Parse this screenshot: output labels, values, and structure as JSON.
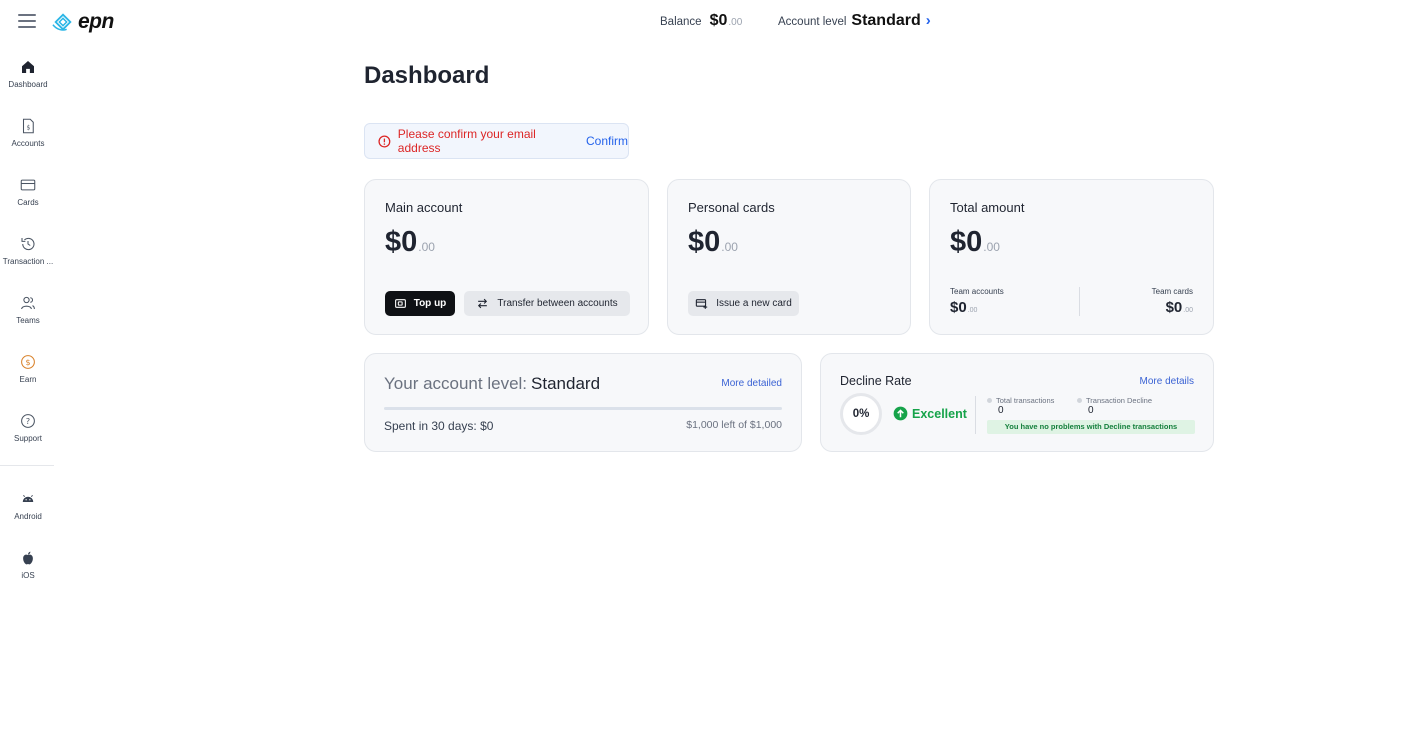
{
  "header": {
    "brand": "epn",
    "balance_label": "Balance",
    "balance_amount": "$0",
    "balance_cents": ".00",
    "account_level_label": "Account level",
    "account_level_value": "Standard",
    "account_level_chevron": "›"
  },
  "sidebar": {
    "items": [
      {
        "label": "Dashboard",
        "icon": "home-icon"
      },
      {
        "label": "Accounts",
        "icon": "accounts-icon"
      },
      {
        "label": "Cards",
        "icon": "card-icon"
      },
      {
        "label": "Transaction ...",
        "icon": "history-icon"
      },
      {
        "label": "Teams",
        "icon": "teams-icon"
      },
      {
        "label": "Earn",
        "icon": "earn-coin-icon"
      },
      {
        "label": "Support",
        "icon": "help-icon"
      }
    ],
    "apps": [
      {
        "label": "Android",
        "icon": "android-icon"
      },
      {
        "label": "iOS",
        "icon": "apple-icon"
      }
    ]
  },
  "main": {
    "title": "Dashboard",
    "alert": {
      "text": "Please confirm your email address",
      "link": "Confirm",
      "color": "#dc2626"
    },
    "main_account": {
      "title": "Main account",
      "amount": "$0",
      "cents": ".00",
      "topup_label": "Top up",
      "transfer_label": "Transfer between accounts"
    },
    "personal_cards": {
      "title": "Personal cards",
      "amount": "$0",
      "cents": ".00",
      "issue_label": "Issue a new card"
    },
    "total_amount": {
      "title": "Total amount",
      "amount": "$0",
      "cents": ".00",
      "team_accounts_label": "Team accounts",
      "team_accounts_amount": "$0",
      "team_accounts_cents": ".00",
      "team_cards_label": "Team cards",
      "team_cards_amount": "$0",
      "team_cards_cents": ".00"
    },
    "account_level": {
      "prefix": "Your account level:",
      "value": "Standard",
      "more_link": "More detailed",
      "progress_percent": 0,
      "spent_text": "Spent in 30 days: $0",
      "left_text": "$1,000 left of $1,000"
    },
    "decline_rate": {
      "title": "Decline Rate",
      "more_link": "More details",
      "percent": "0%",
      "status": "Excellent",
      "total_tx_label": "Total transactions",
      "total_tx_value": "0",
      "decline_tx_label": "Transaction Decline",
      "decline_tx_value": "0",
      "note": "You have no problems with Decline transactions"
    }
  },
  "colors": {
    "accent": "#2563eb",
    "success": "#16a34a",
    "error": "#dc2626",
    "logo": "#2bb6e6",
    "earn": "#d9822b"
  }
}
